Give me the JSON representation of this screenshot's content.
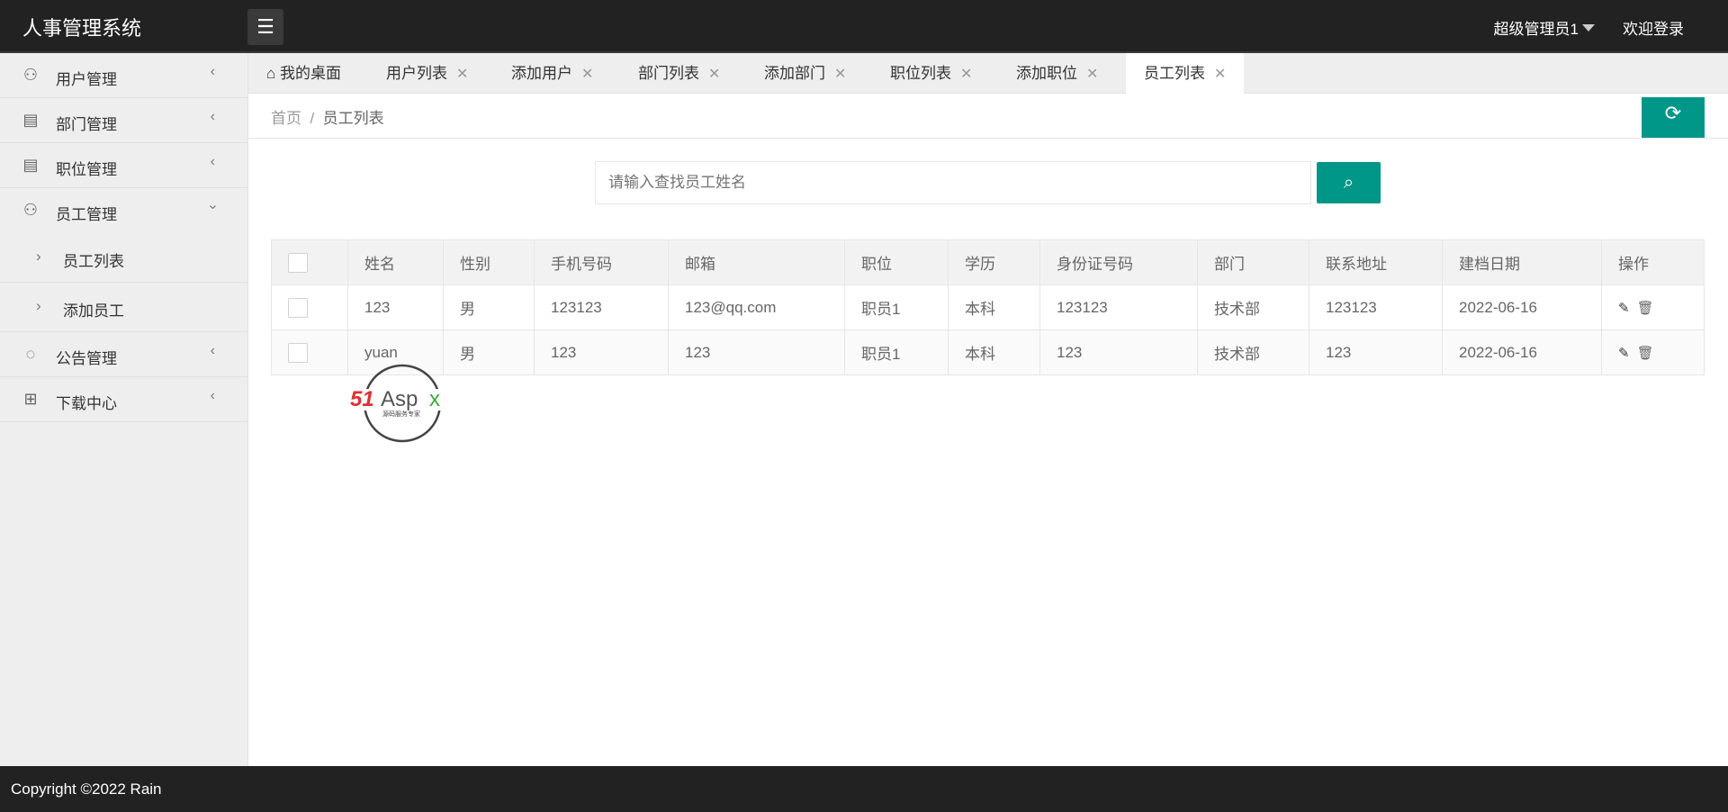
{
  "header": {
    "title": "人事管理系统",
    "menu_icon": "list-icon",
    "user": "超级管理员1",
    "welcome": "欢迎登录"
  },
  "sidebar": {
    "items": [
      {
        "label": "用户管理",
        "icon": "user-icon"
      },
      {
        "label": "部门管理",
        "icon": "document-icon"
      },
      {
        "label": "职位管理",
        "icon": "document-icon"
      },
      {
        "label": "员工管理",
        "icon": "user-tie-icon",
        "expanded": true,
        "children": [
          {
            "label": "员工列表"
          },
          {
            "label": "添加员工"
          }
        ]
      },
      {
        "label": "公告管理",
        "icon": "share-icon"
      },
      {
        "label": "下载中心",
        "icon": "grid-icon"
      }
    ]
  },
  "tabs": [
    {
      "label": "我的桌面"
    },
    {
      "label": "用户列表"
    },
    {
      "label": "添加用户"
    },
    {
      "label": "部门列表"
    },
    {
      "label": "添加部门"
    },
    {
      "label": "职位列表"
    },
    {
      "label": "添加职位"
    },
    {
      "label": "员工列表",
      "active": true
    }
  ],
  "breadcrumb": {
    "home": "首页",
    "sep": "/",
    "current": "员工列表"
  },
  "search": {
    "placeholder": "请输入查找员工姓名"
  },
  "table": {
    "headers": [
      "姓名",
      "性别",
      "手机号码",
      "邮箱",
      "职位",
      "学历",
      "身份证号码",
      "部门",
      "联系地址",
      "建档日期",
      "操作"
    ],
    "rows": [
      [
        "123",
        "男",
        "123123",
        "123@qq.com",
        "职员1",
        "本科",
        "123123",
        "技术部",
        "123123",
        "2022-06-16"
      ],
      [
        "yuan",
        "男",
        "123",
        "123",
        "职员1",
        "本科",
        "123",
        "技术部",
        "123",
        "2022-06-16"
      ]
    ]
  },
  "watermark": {
    "text": "51Aspx",
    "sub": "源码服务专家"
  },
  "footer": {
    "text": "Copyright ©2022 Rain"
  },
  "colors": {
    "accent": "#009688",
    "header": "#222222"
  }
}
